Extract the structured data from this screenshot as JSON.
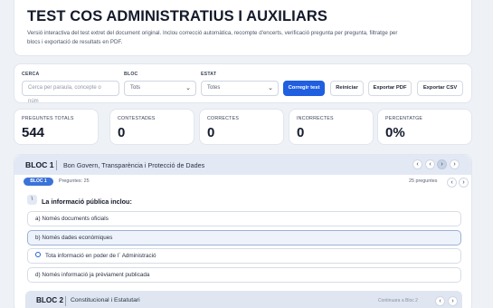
{
  "header": {
    "title": "TEST COS ADMINISTRATIUS I AUXILIARS",
    "description": "Versió interactiva del test extret del document original. Inclou correcció automàtica, recompte d'encerts, verificació pregunta per pregunta, filtratge per blocs i exportació de resultats en PDF."
  },
  "filters": {
    "search_label": "CERCA",
    "search_placeholder": "Cerca per paraula, concepte o núm",
    "bloc_label": "BLOC",
    "bloc_value": "Tots",
    "status_label": "ESTAT",
    "status_value": "Totes",
    "correct_button": "Corregir test",
    "reset_button": "Reiniciar",
    "pdf_button": "Exportar PDF",
    "csv_button": "Exportar CSV"
  },
  "stats": [
    {
      "label": "PREGUNTES TOTALS",
      "value": "544"
    },
    {
      "label": "CONTESTADES",
      "value": "0"
    },
    {
      "label": "CORRECTES",
      "value": "0"
    },
    {
      "label": "INCORRECTES",
      "value": "0"
    },
    {
      "label": "PERCENTATGE",
      "value": "0%"
    }
  ],
  "bloc1": {
    "title": "BLOC 1",
    "name": "Bon Govern, Transparència i Protecció de Dades",
    "pill": "BLOC 1",
    "count_left": "Preguntes: 25",
    "count_right": "25 preguntes",
    "question": "La informació pública inclou:",
    "options": [
      "a)  Només documents oficials",
      "b)  Només dades econòmiques",
      "Tota informació en poder de l´ Administració",
      "d)  Només informació ja prèviament publicada"
    ]
  },
  "bloc2": {
    "title": "BLOC 2",
    "name": "Constitucional i Estatutari",
    "hint": "Continuara a Bloc 2"
  },
  "icons": {
    "nav_prev": "‹",
    "nav_next": "›",
    "question_icon": "\\"
  }
}
